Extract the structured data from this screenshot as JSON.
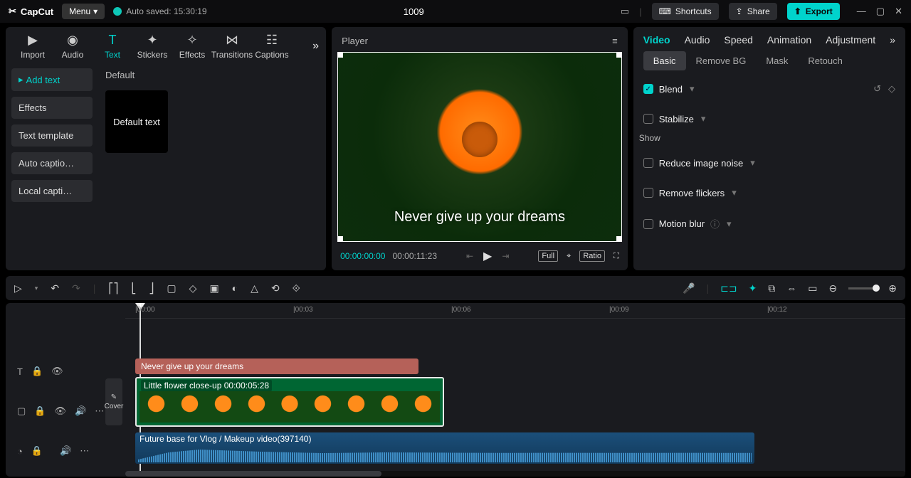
{
  "titlebar": {
    "app": "CapCut",
    "menu": "Menu",
    "autosave": "Auto saved: 15:30:19",
    "project": "1009",
    "shortcuts": "Shortcuts",
    "share": "Share",
    "export": "Export"
  },
  "leftPanel": {
    "tabs": [
      "Import",
      "Audio",
      "Text",
      "Stickers",
      "Effects",
      "Transitions",
      "Captions"
    ],
    "activeTab": "Text",
    "sidebar": {
      "addText": "Add text",
      "effects": "Effects",
      "textTemplate": "Text template",
      "autoCaptions": "Auto captio…",
      "localCaptions": "Local capti…"
    },
    "contentHeader": "Default",
    "defaultTextCard": "Default text"
  },
  "player": {
    "title": "Player",
    "caption": "Never give up your dreams",
    "tcCurrent": "00:00:00:00",
    "tcTotal": "00:00:11:23",
    "full": "Full",
    "ratio": "Ratio"
  },
  "rightPanel": {
    "tabs": [
      "Video",
      "Audio",
      "Speed",
      "Animation",
      "Adjustment"
    ],
    "subtabs": {
      "basic": "Basic",
      "removeBg": "Remove BG",
      "mask": "Mask",
      "retouch": "Retouch"
    },
    "blend": "Blend",
    "stabilize": "Stabilize",
    "show": "Show",
    "reduceNoise": "Reduce image noise",
    "removeFlickers": "Remove flickers",
    "motionBlur": "Motion blur"
  },
  "ruler": {
    "marks": [
      {
        "label": "|00:00",
        "pos": 14
      },
      {
        "label": "|00:03",
        "pos": 236
      },
      {
        "label": "|00:06",
        "pos": 458
      },
      {
        "label": "|00:09",
        "pos": 680
      },
      {
        "label": "|00:12",
        "pos": 902
      }
    ]
  },
  "timeline": {
    "cover": "Cover",
    "textClip": "Never give up your dreams",
    "videoClip": "Little flower close-up  00:00:05:28",
    "audioClip": "Future base for Vlog / Makeup video(397140)"
  }
}
